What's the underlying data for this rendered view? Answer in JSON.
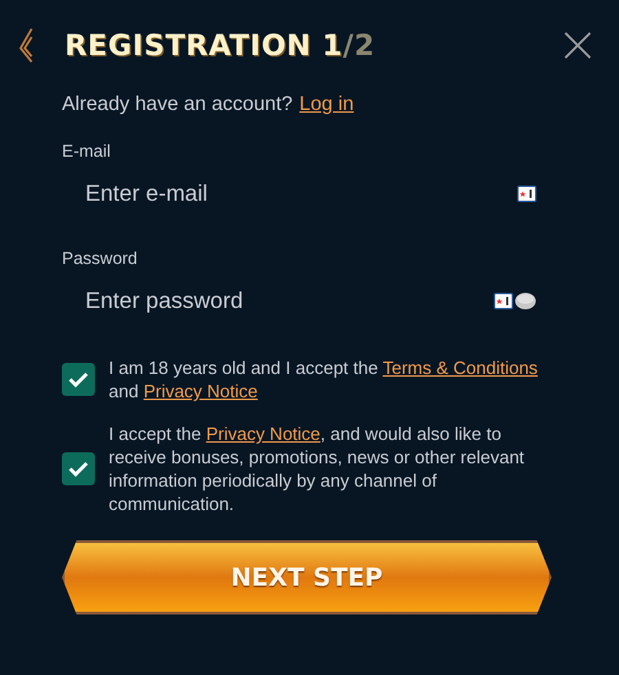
{
  "header": {
    "title_parts": [
      {
        "text": "REGISTRATION 1",
        "dim": false
      },
      {
        "text": "/2",
        "dim": true
      }
    ]
  },
  "login_prompt": {
    "text": "Already have an account?",
    "link": "Log in"
  },
  "fields": [
    {
      "kind": "email",
      "label": "E-mail",
      "placeholder": "Enter e-mail"
    },
    {
      "kind": "password",
      "label": "Password",
      "placeholder": "Enter password"
    }
  ],
  "consents": [
    {
      "checked": true,
      "parts": [
        {
          "text": "I am 18 years old and I accept the ",
          "link": false
        },
        {
          "text": "Terms & Conditions",
          "link": true
        },
        {
          "text": " and ",
          "link": false
        },
        {
          "text": "Privacy Notice",
          "link": true
        }
      ]
    },
    {
      "checked": true,
      "parts": [
        {
          "text": "I accept the ",
          "link": false
        },
        {
          "text": "Privacy Notice",
          "link": true
        },
        {
          "text": ", and would also like to receive bonuses, promotions, news or other relevant information periodically by any channel of communication.",
          "link": false
        }
      ]
    }
  ],
  "submit": "NEXT STEP"
}
